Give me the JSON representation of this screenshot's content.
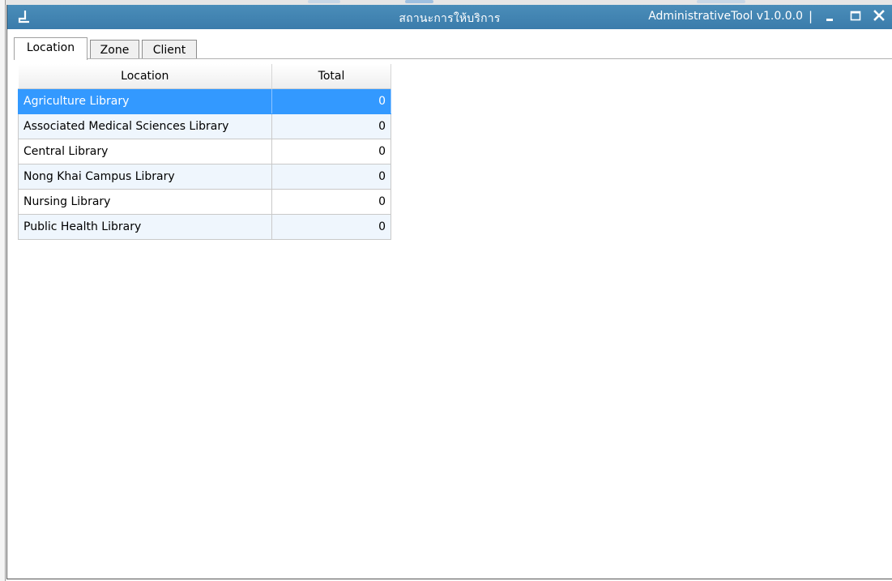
{
  "window": {
    "title": "สถานะการให้บริการ",
    "app_version": "AdministrativeTool v1.0.0.0",
    "separator": "|",
    "accent_color": "#3b7cab",
    "controls": [
      {
        "name": "minimize",
        "icon": "minimize-icon"
      },
      {
        "name": "maximize",
        "icon": "maximize-icon"
      },
      {
        "name": "close",
        "icon": "close-icon"
      }
    ]
  },
  "tabs": [
    {
      "label": "Location",
      "active": true
    },
    {
      "label": "Zone",
      "active": false
    },
    {
      "label": "Client",
      "active": false
    }
  ],
  "table": {
    "headers": [
      "Location",
      "Total"
    ],
    "rows": [
      {
        "location": "Agriculture Library",
        "total": "0",
        "selected": true
      },
      {
        "location": "Associated Medical Sciences Library",
        "total": "0",
        "selected": false
      },
      {
        "location": "Central Library",
        "total": "0",
        "selected": false
      },
      {
        "location": "Nong Khai Campus Library",
        "total": "0",
        "selected": false
      },
      {
        "location": "Nursing Library",
        "total": "0",
        "selected": false
      },
      {
        "location": "Public Health Library",
        "total": "0",
        "selected": false
      }
    ],
    "selection_color": "#3399ff",
    "alt_row_color": "#eff6fd"
  }
}
